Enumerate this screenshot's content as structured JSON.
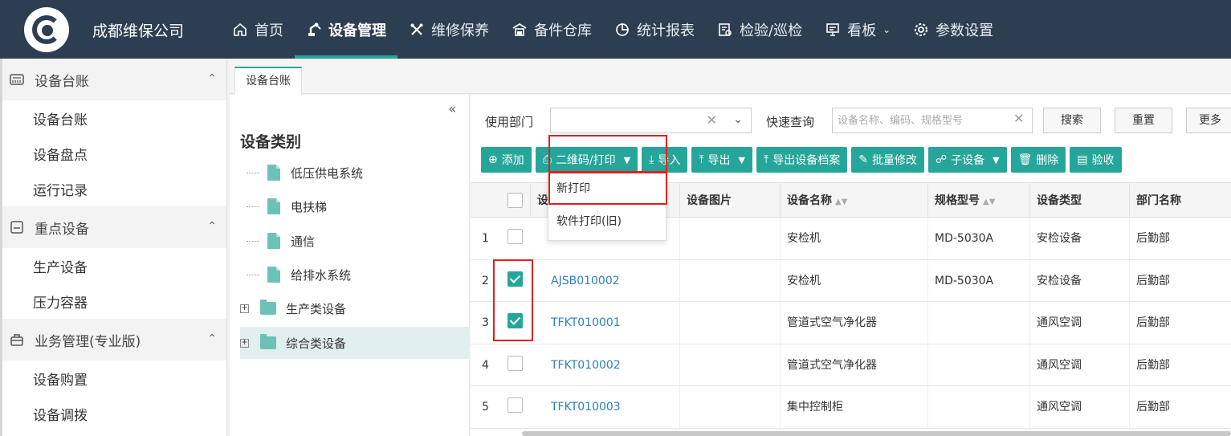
{
  "header": {
    "company": "成都维保公司",
    "nav": [
      {
        "label": "首页",
        "icon": "home-icon"
      },
      {
        "label": "设备管理",
        "icon": "robot-arm-icon",
        "active": true
      },
      {
        "label": "维修保养",
        "icon": "tools-icon"
      },
      {
        "label": "备件仓库",
        "icon": "warehouse-icon"
      },
      {
        "label": "统计报表",
        "icon": "pie-chart-icon"
      },
      {
        "label": "检验/巡检",
        "icon": "inspection-icon"
      },
      {
        "label": "看板",
        "icon": "board-icon",
        "has_dropdown": true
      },
      {
        "label": "参数设置",
        "icon": "gear-icon"
      }
    ]
  },
  "sidebar": {
    "groups": [
      {
        "label": "设备台账",
        "icon": "ledger-icon",
        "items": [
          "设备台账",
          "设备盘点",
          "运行记录"
        ]
      },
      {
        "label": "重点设备",
        "icon": "key-device-icon",
        "items": [
          "生产设备",
          "压力容器"
        ]
      },
      {
        "label": "业务管理(专业版)",
        "icon": "business-icon",
        "items": [
          "设备购置",
          "设备调拨"
        ]
      }
    ]
  },
  "tab": {
    "label": "设备台账"
  },
  "tree": {
    "title": "设备类别",
    "collapse_glyph": "«",
    "nodes": [
      {
        "label": "低压供电系统",
        "type": "file"
      },
      {
        "label": "电扶梯",
        "type": "file"
      },
      {
        "label": "通信",
        "type": "file"
      },
      {
        "label": "给排水系统",
        "type": "file"
      },
      {
        "label": "生产类设备",
        "type": "folder"
      },
      {
        "label": "综合类设备",
        "type": "folder",
        "selected": true
      }
    ]
  },
  "filters": {
    "dept_label": "使用部门",
    "quick_label": "快速查询",
    "quick_placeholder": "设备名称、编码、规格型号",
    "search_btn": "搜索",
    "reset_btn": "重置",
    "more_btn": "更多"
  },
  "toolbar": {
    "add": "添加",
    "qrprint": "二维码/打印",
    "import": "导入",
    "export": "导出",
    "export_archive": "导出设备档案",
    "batch_edit": "批量修改",
    "sub_device": "子设备",
    "delete": "删除",
    "accept": "验收"
  },
  "dropdown": {
    "items": [
      "新打印",
      "软件打印(旧)"
    ]
  },
  "table": {
    "headers": [
      "设",
      "设备图片",
      "设备名称",
      "规格型号",
      "设备类型",
      "部门名称"
    ],
    "rows": [
      {
        "no": "1",
        "checked": false,
        "code": "",
        "image": "",
        "name": "安检机",
        "model": "MD-5030A",
        "type": "安检设备",
        "dept": "后勤部"
      },
      {
        "no": "2",
        "checked": true,
        "code": "AJSB010002",
        "image": "",
        "name": "安检机",
        "model": "MD-5030A",
        "type": "安检设备",
        "dept": "后勤部"
      },
      {
        "no": "3",
        "checked": true,
        "code": "TFKT010001",
        "image": "",
        "name": "管道式空气净化器",
        "model": "",
        "type": "通风空调",
        "dept": "后勤部"
      },
      {
        "no": "4",
        "checked": false,
        "code": "TFKT010002",
        "image": "",
        "name": "管道式空气净化器",
        "model": "",
        "type": "通风空调",
        "dept": "后勤部"
      },
      {
        "no": "5",
        "checked": false,
        "code": "TFKT010003",
        "image": "",
        "name": "集中控制柜",
        "model": "",
        "type": "通风空调",
        "dept": "后勤部"
      }
    ]
  },
  "colors": {
    "topbar": "#2e3e52",
    "accent": "#26a69a",
    "link": "#2f7fc1",
    "highlight": "#e02020"
  }
}
